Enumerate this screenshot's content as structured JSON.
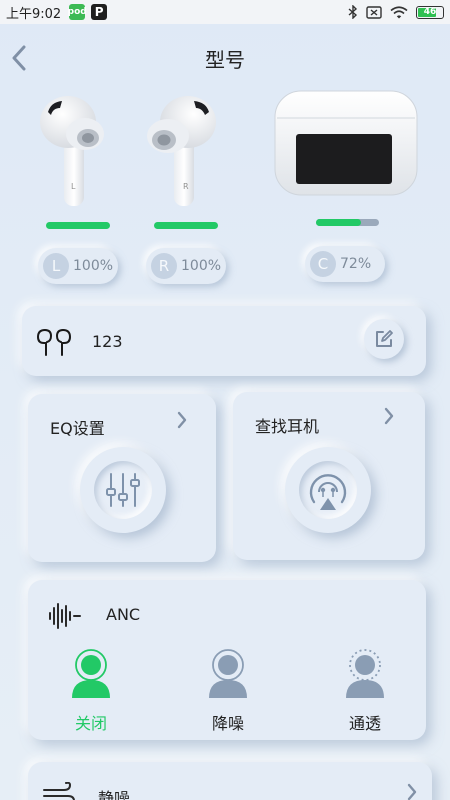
{
  "status_bar": {
    "time": "上午9:02",
    "app_icons": [
      "pod-app-icon",
      "p-app-icon"
    ],
    "app_icon_texts": [
      "pod",
      "P"
    ],
    "battery": "46"
  },
  "header": {
    "title": "型号"
  },
  "earbuds": {
    "left": {
      "side_letter": "L",
      "percent": "100%",
      "level": 1.0
    },
    "right": {
      "side_letter": "R",
      "percent": "100%",
      "level": 1.0
    },
    "case": {
      "side_letter": "C",
      "percent": "72%",
      "level": 0.72
    }
  },
  "device": {
    "name": "123"
  },
  "eq_card": {
    "title": "EQ设置"
  },
  "find_card": {
    "title": "查找耳机"
  },
  "anc": {
    "title": "ANC",
    "modes": [
      {
        "label": "关闭",
        "selected": true
      },
      {
        "label": "降噪",
        "selected": false
      },
      {
        "label": "通透",
        "selected": false
      }
    ]
  },
  "quiet_card": {
    "title": "静噪"
  },
  "colors": {
    "accent": "#22c966",
    "inactive": "#8a9db4",
    "background": "#e3ebf5"
  }
}
